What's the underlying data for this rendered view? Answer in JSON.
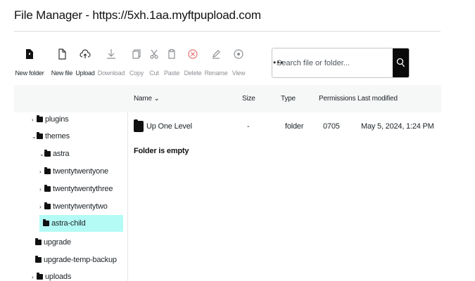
{
  "header": {
    "title": "File Manager - https://5xh.1aa.myftpupload.com"
  },
  "toolbar": {
    "new_folder": "New folder",
    "new_file": "New file",
    "upload": "Upload",
    "download": "Download",
    "copy": "Copy",
    "cut": "Cut",
    "paste": "Paste",
    "delete": "Delete",
    "rename": "Rename",
    "view": "View",
    "more": "•••"
  },
  "search": {
    "placeholder": "Search file or folder..."
  },
  "columns": {
    "name": "Name ⌄",
    "size": "Size",
    "type": "Type",
    "permissions": "Permissions",
    "last_modified": "Last modified"
  },
  "tree": {
    "items": [
      {
        "label": "plugins",
        "chevron": "›"
      },
      {
        "label": "themes",
        "chevron": "⌄"
      },
      {
        "label": "astra",
        "chevron": "⌄"
      },
      {
        "label": "twentytwentyone",
        "chevron": "›"
      },
      {
        "label": "twentytwentythree",
        "chevron": "›"
      },
      {
        "label": "twentytwentytwo",
        "chevron": "›"
      },
      {
        "label": "astra-child",
        "chevron": ""
      },
      {
        "label": "upgrade",
        "chevron": ""
      },
      {
        "label": "upgrade-temp-backup",
        "chevron": ""
      },
      {
        "label": "uploads",
        "chevron": "›"
      }
    ]
  },
  "files": {
    "rows": [
      {
        "name": "Up One Level",
        "size": "-",
        "type": "folder",
        "permissions": "0705",
        "modified": "May 5, 2024, 1:24 PM"
      }
    ],
    "empty_message": "Folder is empty"
  },
  "colors": {
    "accent": "#0a0a0a",
    "active_highlight": "#b4fbf5",
    "disabled_icon": "#8c8f94",
    "delete_icon": "#e26f6f"
  }
}
